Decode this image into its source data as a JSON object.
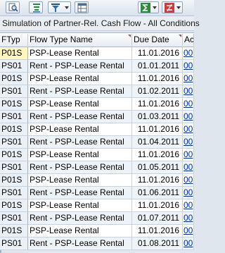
{
  "window": {
    "title": "Simulation of Partner-Rel. Cash Flow - All Conditions"
  },
  "toolbar": {
    "buttons": [
      {
        "icon": "detail-magnifier-icon",
        "dropdown": false
      },
      {
        "icon": "sort-ascending-icon",
        "dropdown": false
      },
      {
        "icon": "filter-icon",
        "dropdown": true
      },
      {
        "icon": "grid-layout-icon",
        "dropdown": false
      },
      {
        "icon": "sum-icon",
        "dropdown": true
      },
      {
        "icon": "subtotal-icon",
        "dropdown": true
      }
    ]
  },
  "table": {
    "columns": [
      "FTyp",
      "Flow Type Name",
      "Due Date",
      "Ac"
    ],
    "rows": [
      {
        "ftyp": "P01S",
        "name": "PSP-Lease Rental",
        "date": "11.01.2016",
        "ac": "00"
      },
      {
        "ftyp": "PS01",
        "name": "Rent - PSP-Lease Rental",
        "date": "01.01.2011",
        "ac": "00"
      },
      {
        "ftyp": "P01S",
        "name": "PSP-Lease Rental",
        "date": "11.01.2016",
        "ac": "00"
      },
      {
        "ftyp": "PS01",
        "name": "Rent - PSP-Lease Rental",
        "date": "01.02.2011",
        "ac": "00"
      },
      {
        "ftyp": "P01S",
        "name": "PSP-Lease Rental",
        "date": "11.01.2016",
        "ac": "00"
      },
      {
        "ftyp": "PS01",
        "name": "Rent - PSP-Lease Rental",
        "date": "01.03.2011",
        "ac": "00"
      },
      {
        "ftyp": "P01S",
        "name": "PSP-Lease Rental",
        "date": "11.01.2016",
        "ac": "00"
      },
      {
        "ftyp": "PS01",
        "name": "Rent - PSP-Lease Rental",
        "date": "01.04.2011",
        "ac": "00"
      },
      {
        "ftyp": "P01S",
        "name": "PSP-Lease Rental",
        "date": "11.01.2016",
        "ac": "00"
      },
      {
        "ftyp": "PS01",
        "name": "Rent - PSP-Lease Rental",
        "date": "01.05.2011",
        "ac": "00"
      },
      {
        "ftyp": "P01S",
        "name": "PSP-Lease Rental",
        "date": "11.01.2016",
        "ac": "00"
      },
      {
        "ftyp": "PS01",
        "name": "Rent - PSP-Lease Rental",
        "date": "01.06.2011",
        "ac": "00"
      },
      {
        "ftyp": "P01S",
        "name": "PSP-Lease Rental",
        "date": "11.01.2016",
        "ac": "00"
      },
      {
        "ftyp": "PS01",
        "name": "Rent - PSP-Lease Rental",
        "date": "01.07.2011",
        "ac": "00"
      },
      {
        "ftyp": "P01S",
        "name": "PSP-Lease Rental",
        "date": "11.01.2016",
        "ac": "00"
      },
      {
        "ftyp": "PS01",
        "name": "Rent - PSP-Lease Rental",
        "date": "01.08.2011",
        "ac": "00"
      }
    ],
    "selected_row": 0
  },
  "colors": {
    "selected_cell": "#fff6bf",
    "link": "#00309a",
    "sort_marker": "#d04040"
  }
}
